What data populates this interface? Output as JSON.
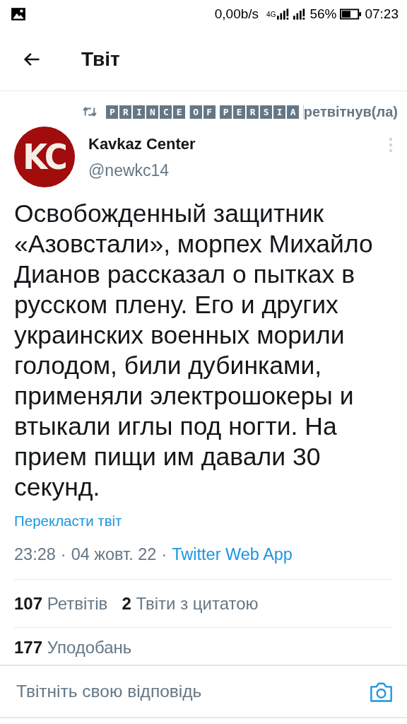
{
  "status_bar": {
    "speed": "0,00b/s",
    "network": "4G",
    "battery_percent": "56%",
    "time": "07:23"
  },
  "header": {
    "title": "Твіт"
  },
  "retweet": {
    "user": "PRINCE OF PERSIA",
    "action": "ретвітнув(ла)"
  },
  "tweet": {
    "name": "Kavkaz Center",
    "handle": "@newkc14",
    "avatar_text": "KC",
    "text": "Освобожденный защитник «Азовстали», морпех Михайло Дианов рассказал о пытках в русском плену. Его и других украинских военных морили голодом, били дубинками, применяли электрошокеры и втыкали иглы под ногти. На прием пищи им давали 30 секунд.",
    "translate": "Перекласти твіт",
    "meta": [
      {
        "kind": "time",
        "text": "23:28"
      },
      {
        "kind": "separator",
        "text": "·"
      },
      {
        "kind": "date",
        "text": "04 жовт. 22"
      },
      {
        "kind": "separator",
        "text": "·"
      },
      {
        "kind": "source",
        "text": "Twitter Web App"
      }
    ]
  },
  "stats": [
    {
      "count": "107",
      "label": "Ретвітів"
    },
    {
      "count": "2",
      "label": "Твіти з цитатою"
    },
    {
      "count": "177",
      "label": "Уподобань"
    }
  ],
  "reply": {
    "placeholder": "Твітніть свою відповідь"
  }
}
